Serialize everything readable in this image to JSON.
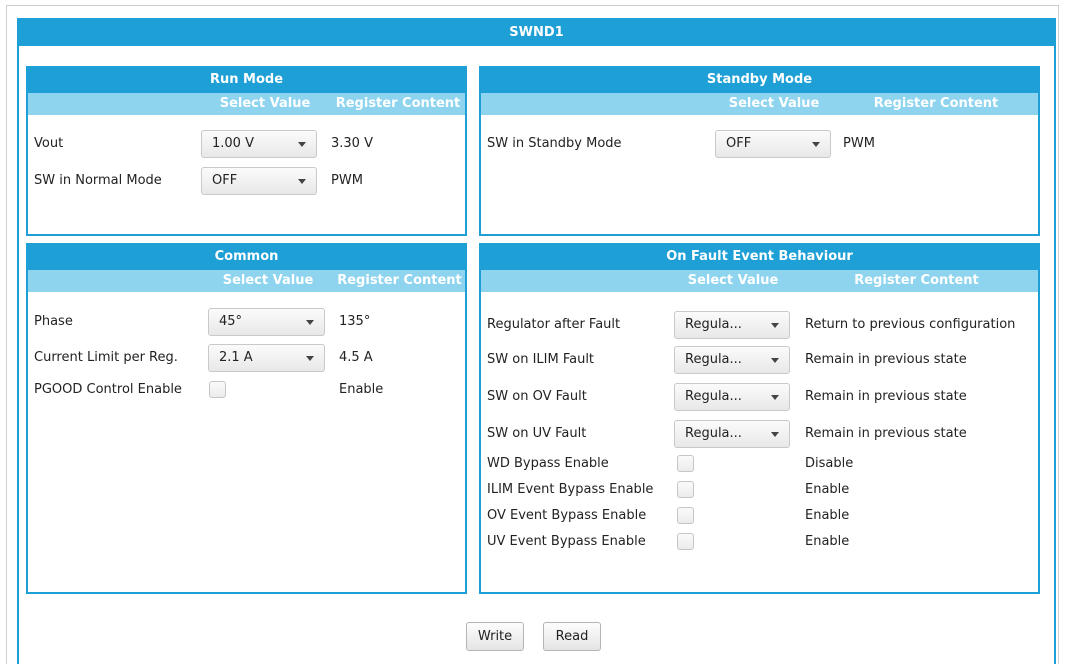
{
  "device_title": "SWND1",
  "columns": {
    "select": "Select Value",
    "register": "Register Content"
  },
  "run_mode": {
    "title": "Run Mode",
    "rows": [
      {
        "label": "Vout",
        "select": "1.00 V",
        "register": "3.30 V"
      },
      {
        "label": "SW in Normal Mode",
        "select": "OFF",
        "register": "PWM"
      }
    ]
  },
  "standby_mode": {
    "title": "Standby Mode",
    "rows": [
      {
        "label": "SW in Standby Mode",
        "select": "OFF",
        "register": "PWM"
      }
    ]
  },
  "common": {
    "title": "Common",
    "rows": [
      {
        "label": "Phase",
        "select": "45°",
        "register": "135°"
      },
      {
        "label": "Current Limit per Reg.",
        "select": "2.1 A",
        "register": "4.5 A"
      }
    ],
    "checkbox_rows": [
      {
        "label": "PGOOD Control Enable",
        "checked": false,
        "register": "Enable"
      }
    ]
  },
  "fault": {
    "title": "On Fault Event Behaviour",
    "rows": [
      {
        "label": "Regulator after Fault",
        "select": "Regula...",
        "register": "Return to previous configuration"
      },
      {
        "label": "SW on ILIM Fault",
        "select": "Regula...",
        "register": "Remain in previous state"
      },
      {
        "label": "SW on OV Fault",
        "select": "Regula...",
        "register": "Remain in previous state"
      },
      {
        "label": "SW on UV Fault",
        "select": "Regula...",
        "register": "Remain in previous state"
      }
    ],
    "checkbox_rows": [
      {
        "label": "WD Bypass Enable",
        "checked": false,
        "register": "Disable"
      },
      {
        "label": "ILIM Event Bypass Enable",
        "checked": false,
        "register": "Enable"
      },
      {
        "label": "OV Event Bypass Enable",
        "checked": false,
        "register": "Enable"
      },
      {
        "label": "UV Event Bypass Enable",
        "checked": false,
        "register": "Enable"
      }
    ]
  },
  "buttons": {
    "write": "Write",
    "read": "Read"
  },
  "colors": {
    "accent": "#1e9fd6",
    "header_light": "#8ed4ef"
  }
}
